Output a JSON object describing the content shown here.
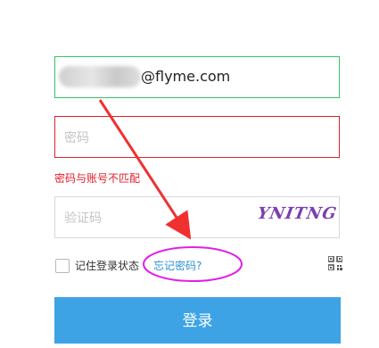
{
  "email_field": {
    "value_suffix": "@flyme.com"
  },
  "password_field": {
    "placeholder": "密码"
  },
  "error_message": "密码与账号不匹配",
  "captcha_field": {
    "placeholder": "验证码",
    "captcha_text": "YNITNG"
  },
  "remember_label": "记住登录状态",
  "forgot_password_link": "忘记密码?",
  "login_button": "登录",
  "colors": {
    "valid_border": "#35c266",
    "error": "#e0202a",
    "link": "#2b8fd6",
    "primary_button": "#3da3e5",
    "annotation_arrow": "#f03030",
    "annotation_circle": "#e020e8"
  },
  "icons": {
    "qr": "qr-code-icon"
  }
}
